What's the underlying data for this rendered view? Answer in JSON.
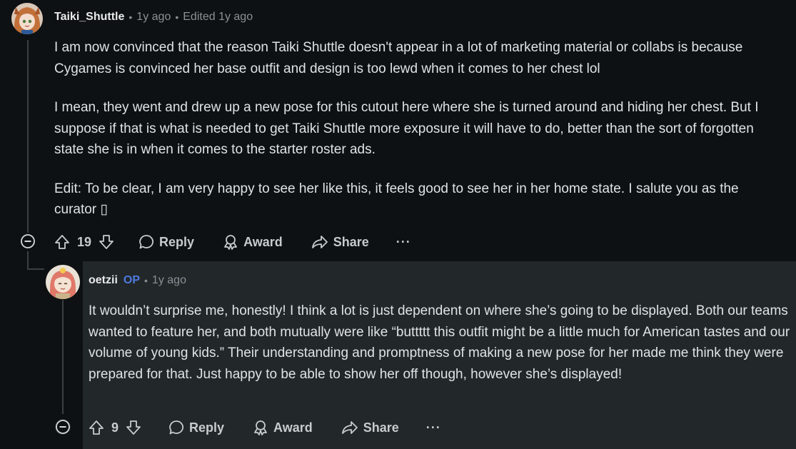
{
  "comment": {
    "author": "Taiki_Shuttle",
    "time": "1y ago",
    "edited": "Edited 1y ago",
    "paragraphs": [
      "I am now convinced that the reason Taiki Shuttle doesn't appear in a lot of marketing material or collabs is because Cygames is convinced her base outfit and design is too lewd when it comes to her chest lol",
      "I mean, they went and drew up a new pose for this cutout here where she is turned around and hiding her chest. But I suppose if that is what is needed to get Taiki Shuttle more exposure it will have to do, better than the sort of forgotten state she is in when it comes to the starter roster ads.",
      "Edit: To be clear, I am very happy to see her like this, it feels good to see her in her home state. I salute you as the curator ▯"
    ],
    "votes": "19",
    "reply_label": "Reply",
    "award_label": "Award",
    "share_label": "Share",
    "more_label": "···"
  },
  "reply": {
    "author": "oetzii",
    "op_badge": "OP",
    "time": "1y ago",
    "paragraphs": [
      "It wouldn’t surprise me, honestly! I think a lot is just dependent on where she’s going to be displayed. Both our teams wanted to feature her, and both mutually were like “buttttt this outfit might be a little much for American tastes and our volume of young kids.” Their understanding and promptness of making a new pose for her made me think they were prepared for that. Just happy to be able to show her off though, however she’s displayed!"
    ],
    "votes": "9",
    "reply_label": "Reply",
    "award_label": "Award",
    "share_label": "Share",
    "more_label": "···"
  },
  "icons": {
    "upvote": "arrow-up-icon",
    "downvote": "arrow-down-icon",
    "reply": "speech-bubble-icon",
    "award": "award-ribbon-icon",
    "share": "share-arrow-icon",
    "collapse": "minus-circle-icon"
  },
  "colors": {
    "background": "#0e1113",
    "reply_background": "#22272a",
    "op_badge": "#4e7be0",
    "muted_text": "#8a9196"
  }
}
